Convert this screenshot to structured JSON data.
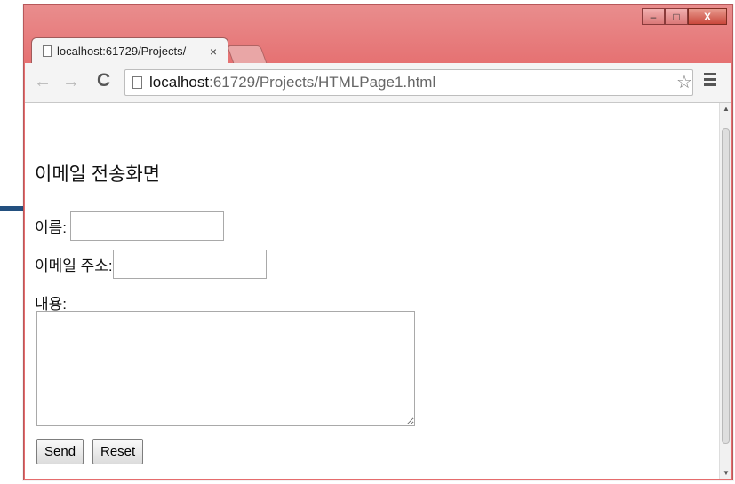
{
  "window": {
    "controls": {
      "minimize": "–",
      "maximize": "□",
      "close": "X"
    }
  },
  "tab": {
    "title": "localhost:61729/Projects/",
    "close": "×"
  },
  "address": {
    "host": "localhost",
    "path": ":61729/Projects/HTMLPage1.html"
  },
  "page": {
    "heading": "이메일 전송화면",
    "name_label": "이름:",
    "email_label": "이메일 주소:",
    "content_label": "내용:",
    "send_label": "Send",
    "reset_label": "Reset"
  },
  "icons": {
    "back": "←",
    "forward": "→",
    "reload": "C",
    "star": "☆",
    "scroll_up": "▲",
    "scroll_down": "▼"
  }
}
